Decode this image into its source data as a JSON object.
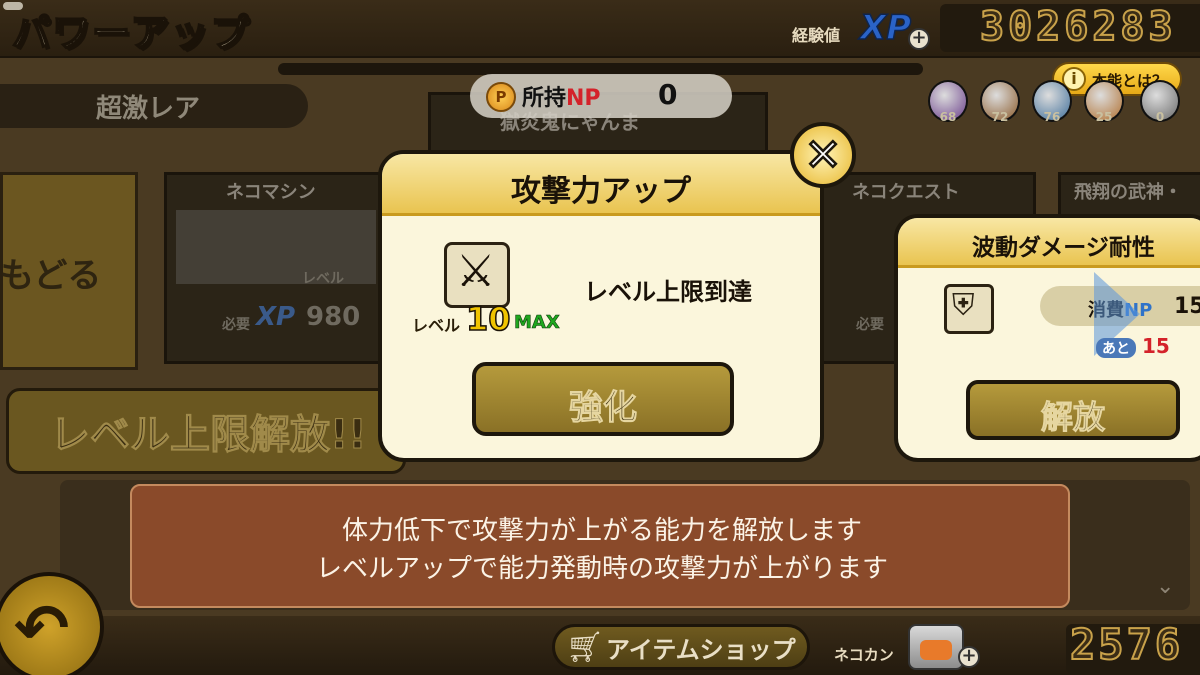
{
  "header": {
    "title": "パワーアップ",
    "xp_label": "経験値",
    "xp_mark": "XP",
    "xp_value": "3026283",
    "plus": "+"
  },
  "np": {
    "coin": "P",
    "label_prefix": "所持",
    "label_np": "NP",
    "value": "0"
  },
  "rarity_tab": "超激レア",
  "info_button": {
    "icon": "i",
    "label": "本能とは？"
  },
  "orbs": [
    {
      "count": "68",
      "color": "#6a3e8a"
    },
    {
      "count": "72",
      "color": "#8a5a2a"
    },
    {
      "count": "76",
      "color": "#3f6f9a"
    },
    {
      "count": "25",
      "color": "#b07030"
    },
    {
      "count": "0",
      "color": "#6a6a6a"
    }
  ],
  "background_cards": {
    "left_title": "ネコマシン",
    "left_level": "レベル",
    "left_required": "必要",
    "left_xp": "XP",
    "left_xp_value": "980",
    "center_title": "獄炎鬼にゃんま",
    "right_title": "ネコクエスト",
    "right_required": "必要",
    "far_right_title": "飛翔の武神・"
  },
  "back_text": "もどる",
  "limit_button": "レベル上限解放!!",
  "description": {
    "line1": "体力低下で攻撃力が上がる能力を解放します",
    "line2": "レベルアップで能力発動時の攻撃力が上がります"
  },
  "dialog": {
    "title": "攻撃力アップ",
    "level_label": "レベル",
    "level": "10",
    "max": "MAX",
    "status": "レベル上限到達",
    "button": "強化",
    "close": "✕"
  },
  "side_panel": {
    "title": "波動ダメージ耐性",
    "cost_label_prefix": "消費",
    "cost_label_np": "NP",
    "cost_value": "15",
    "remain_label": "あと",
    "remain_value": "15",
    "button": "解放"
  },
  "bottom": {
    "shop": "アイテムショップ",
    "can_label": "ネコカン",
    "can_value": "2576",
    "plus": "+"
  },
  "icons": {
    "return": "return-arrow-icon",
    "cart": "cart-icon",
    "sword": "sword-icon",
    "wave_shield": "wave-shield-icon",
    "chevron": "chevron-down-icon"
  }
}
